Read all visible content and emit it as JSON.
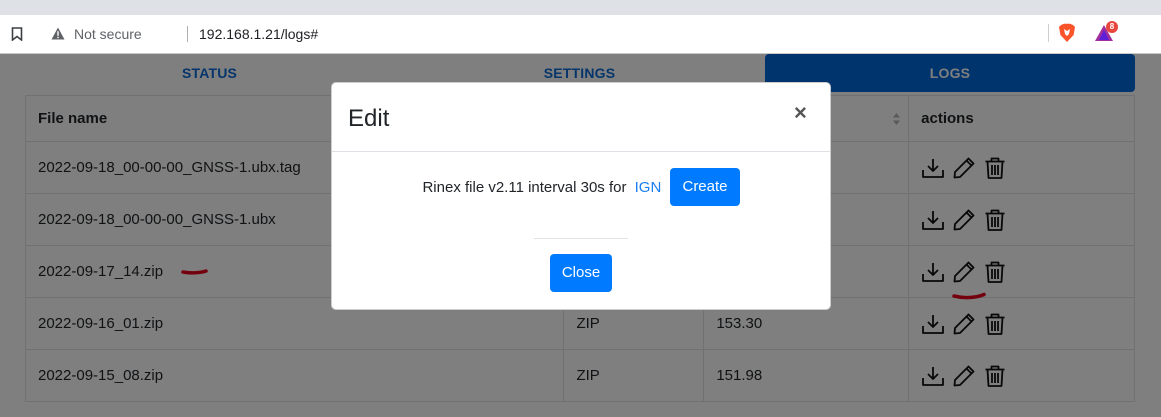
{
  "browser": {
    "security_label": "Not secure",
    "url": "192.168.1.21/logs#",
    "rewards_badge": "8",
    "icons": [
      "bookmark-icon",
      "warning-icon",
      "brave-lion-icon",
      "brave-rewards-icon"
    ]
  },
  "nav": {
    "tabs": [
      {
        "label": "STATUS",
        "active": false
      },
      {
        "label": "SETTINGS",
        "active": false
      },
      {
        "label": "LOGS",
        "active": true
      }
    ]
  },
  "table": {
    "headers": {
      "name": "File name",
      "type": "",
      "size": "",
      "actions": "actions"
    },
    "rows": [
      {
        "name": "2022-09-18_00-00-00_GNSS-1.ubx.tag",
        "type": "",
        "size": ""
      },
      {
        "name": "2022-09-18_00-00-00_GNSS-1.ubx",
        "type": "",
        "size": ""
      },
      {
        "name": "2022-09-17_14.zip",
        "type": "",
        "size": ""
      },
      {
        "name": "2022-09-16_01.zip",
        "type": "ZIP",
        "size": "153.30"
      },
      {
        "name": "2022-09-15_08.zip",
        "type": "ZIP",
        "size": "151.98"
      }
    ],
    "action_icons": [
      "download-icon",
      "edit-pencil-icon",
      "trash-icon"
    ]
  },
  "modal": {
    "title": "Edit",
    "close_symbol": "×",
    "rinex_text": "Rinex file v2.11 interval 30s for",
    "rinex_link": "IGN",
    "create_label": "Create",
    "close_label": "Close"
  },
  "colors": {
    "accent": "#007bff",
    "nav_active": "#0069d9",
    "nav_text": "#0b6ad6",
    "annotation": "#e8001c"
  }
}
